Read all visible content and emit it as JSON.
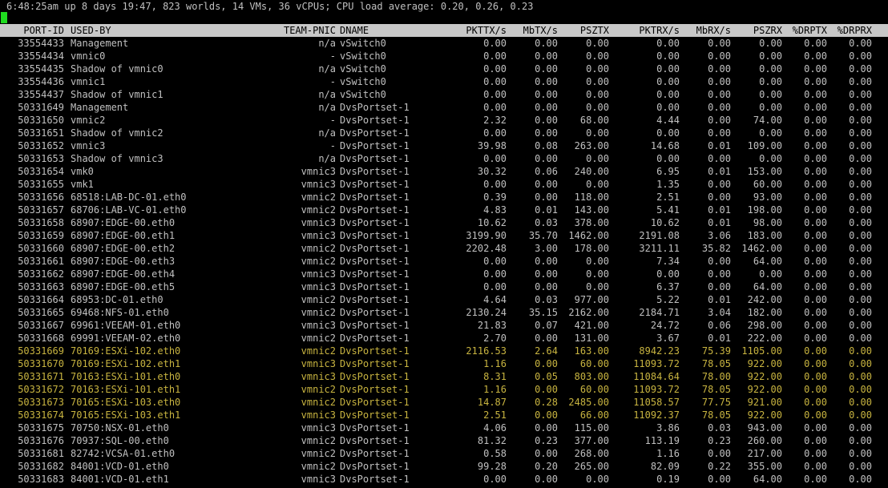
{
  "status_line": "6:48:25am up 8 days 19:47, 823 worlds, 14 VMs, 36 vCPUs; CPU load average: 0.20, 0.26, 0.23",
  "columns": [
    "PORT-ID",
    "USED-BY",
    "TEAM-PNIC",
    "DNAME",
    "PKTTX/s",
    "MbTX/s",
    "PSZTX",
    "PKTRX/s",
    "MbRX/s",
    "PSZRX",
    "%DRPTX",
    "%DRPRX"
  ],
  "rows": [
    [
      "33554433",
      "Management",
      "n/a",
      "vSwitch0",
      "0.00",
      "0.00",
      "0.00",
      "0.00",
      "0.00",
      "0.00",
      "0.00",
      "0.00"
    ],
    [
      "33554434",
      "vmnic0",
      "-",
      "vSwitch0",
      "0.00",
      "0.00",
      "0.00",
      "0.00",
      "0.00",
      "0.00",
      "0.00",
      "0.00"
    ],
    [
      "33554435",
      "Shadow of vmnic0",
      "n/a",
      "vSwitch0",
      "0.00",
      "0.00",
      "0.00",
      "0.00",
      "0.00",
      "0.00",
      "0.00",
      "0.00"
    ],
    [
      "33554436",
      "vmnic1",
      "-",
      "vSwitch0",
      "0.00",
      "0.00",
      "0.00",
      "0.00",
      "0.00",
      "0.00",
      "0.00",
      "0.00"
    ],
    [
      "33554437",
      "Shadow of vmnic1",
      "n/a",
      "vSwitch0",
      "0.00",
      "0.00",
      "0.00",
      "0.00",
      "0.00",
      "0.00",
      "0.00",
      "0.00"
    ],
    [
      "50331649",
      "Management",
      "n/a",
      "DvsPortset-1",
      "0.00",
      "0.00",
      "0.00",
      "0.00",
      "0.00",
      "0.00",
      "0.00",
      "0.00"
    ],
    [
      "50331650",
      "vmnic2",
      "-",
      "DvsPortset-1",
      "2.32",
      "0.00",
      "68.00",
      "4.44",
      "0.00",
      "74.00",
      "0.00",
      "0.00"
    ],
    [
      "50331651",
      "Shadow of vmnic2",
      "n/a",
      "DvsPortset-1",
      "0.00",
      "0.00",
      "0.00",
      "0.00",
      "0.00",
      "0.00",
      "0.00",
      "0.00"
    ],
    [
      "50331652",
      "vmnic3",
      "-",
      "DvsPortset-1",
      "39.98",
      "0.08",
      "263.00",
      "14.68",
      "0.01",
      "109.00",
      "0.00",
      "0.00"
    ],
    [
      "50331653",
      "Shadow of vmnic3",
      "n/a",
      "DvsPortset-1",
      "0.00",
      "0.00",
      "0.00",
      "0.00",
      "0.00",
      "0.00",
      "0.00",
      "0.00"
    ],
    [
      "50331654",
      "vmk0",
      "vmnic3",
      "DvsPortset-1",
      "30.32",
      "0.06",
      "240.00",
      "6.95",
      "0.01",
      "153.00",
      "0.00",
      "0.00"
    ],
    [
      "50331655",
      "vmk1",
      "vmnic3",
      "DvsPortset-1",
      "0.00",
      "0.00",
      "0.00",
      "1.35",
      "0.00",
      "60.00",
      "0.00",
      "0.00"
    ],
    [
      "50331656",
      "68518:LAB-DC-01.eth0",
      "vmnic2",
      "DvsPortset-1",
      "0.39",
      "0.00",
      "118.00",
      "2.51",
      "0.00",
      "93.00",
      "0.00",
      "0.00"
    ],
    [
      "50331657",
      "68706:LAB-VC-01.eth0",
      "vmnic2",
      "DvsPortset-1",
      "4.83",
      "0.01",
      "143.00",
      "5.41",
      "0.01",
      "198.00",
      "0.00",
      "0.00"
    ],
    [
      "50331658",
      "68907:EDGE-00.eth0",
      "vmnic3",
      "DvsPortset-1",
      "10.62",
      "0.03",
      "378.00",
      "10.62",
      "0.01",
      "98.00",
      "0.00",
      "0.00"
    ],
    [
      "50331659",
      "68907:EDGE-00.eth1",
      "vmnic3",
      "DvsPortset-1",
      "3199.90",
      "35.70",
      "1462.00",
      "2191.08",
      "3.06",
      "183.00",
      "0.00",
      "0.00"
    ],
    [
      "50331660",
      "68907:EDGE-00.eth2",
      "vmnic2",
      "DvsPortset-1",
      "2202.48",
      "3.00",
      "178.00",
      "3211.11",
      "35.82",
      "1462.00",
      "0.00",
      "0.00"
    ],
    [
      "50331661",
      "68907:EDGE-00.eth3",
      "vmnic2",
      "DvsPortset-1",
      "0.00",
      "0.00",
      "0.00",
      "7.34",
      "0.00",
      "64.00",
      "0.00",
      "0.00"
    ],
    [
      "50331662",
      "68907:EDGE-00.eth4",
      "vmnic3",
      "DvsPortset-1",
      "0.00",
      "0.00",
      "0.00",
      "0.00",
      "0.00",
      "0.00",
      "0.00",
      "0.00"
    ],
    [
      "50331663",
      "68907:EDGE-00.eth5",
      "vmnic3",
      "DvsPortset-1",
      "0.00",
      "0.00",
      "0.00",
      "6.37",
      "0.00",
      "64.00",
      "0.00",
      "0.00"
    ],
    [
      "50331664",
      "68953:DC-01.eth0",
      "vmnic2",
      "DvsPortset-1",
      "4.64",
      "0.03",
      "977.00",
      "5.22",
      "0.01",
      "242.00",
      "0.00",
      "0.00"
    ],
    [
      "50331665",
      "69468:NFS-01.eth0",
      "vmnic2",
      "DvsPortset-1",
      "2130.24",
      "35.15",
      "2162.00",
      "2184.71",
      "3.04",
      "182.00",
      "0.00",
      "0.00"
    ],
    [
      "50331667",
      "69961:VEEAM-01.eth0",
      "vmnic3",
      "DvsPortset-1",
      "21.83",
      "0.07",
      "421.00",
      "24.72",
      "0.06",
      "298.00",
      "0.00",
      "0.00"
    ],
    [
      "50331668",
      "69991:VEEAM-02.eth0",
      "vmnic2",
      "DvsPortset-1",
      "2.70",
      "0.00",
      "131.00",
      "3.67",
      "0.01",
      "222.00",
      "0.00",
      "0.00"
    ],
    [
      "50331669",
      "70169:ESXi-102.eth0",
      "vmnic2",
      "DvsPortset-1",
      "2116.53",
      "2.64",
      "163.00",
      "8942.23",
      "75.39",
      "1105.00",
      "0.00",
      "0.00"
    ],
    [
      "50331670",
      "70169:ESXi-102.eth1",
      "vmnic3",
      "DvsPortset-1",
      "1.16",
      "0.00",
      "60.00",
      "11093.72",
      "78.05",
      "922.00",
      "0.00",
      "0.00"
    ],
    [
      "50331671",
      "70163:ESXi-101.eth0",
      "vmnic3",
      "DvsPortset-1",
      "8.31",
      "0.05",
      "803.00",
      "11084.64",
      "78.00",
      "922.00",
      "0.00",
      "0.00"
    ],
    [
      "50331672",
      "70163:ESXi-101.eth1",
      "vmnic2",
      "DvsPortset-1",
      "1.16",
      "0.00",
      "60.00",
      "11093.72",
      "78.05",
      "922.00",
      "0.00",
      "0.00"
    ],
    [
      "50331673",
      "70165:ESXi-103.eth0",
      "vmnic2",
      "DvsPortset-1",
      "14.87",
      "0.28",
      "2485.00",
      "11058.57",
      "77.75",
      "921.00",
      "0.00",
      "0.00"
    ],
    [
      "50331674",
      "70165:ESXi-103.eth1",
      "vmnic3",
      "DvsPortset-1",
      "2.51",
      "0.00",
      "66.00",
      "11092.37",
      "78.05",
      "922.00",
      "0.00",
      "0.00"
    ],
    [
      "50331675",
      "70750:NSX-01.eth0",
      "vmnic3",
      "DvsPortset-1",
      "4.06",
      "0.00",
      "115.00",
      "3.86",
      "0.03",
      "943.00",
      "0.00",
      "0.00"
    ],
    [
      "50331676",
      "70937:SQL-00.eth0",
      "vmnic2",
      "DvsPortset-1",
      "81.32",
      "0.23",
      "377.00",
      "113.19",
      "0.23",
      "260.00",
      "0.00",
      "0.00"
    ],
    [
      "50331681",
      "82742:VCSA-01.eth0",
      "vmnic2",
      "DvsPortset-1",
      "0.58",
      "0.00",
      "268.00",
      "1.16",
      "0.00",
      "217.00",
      "0.00",
      "0.00"
    ],
    [
      "50331682",
      "84001:VCD-01.eth0",
      "vmnic2",
      "DvsPortset-1",
      "99.28",
      "0.20",
      "265.00",
      "82.09",
      "0.22",
      "355.00",
      "0.00",
      "0.00"
    ],
    [
      "50331683",
      "84001:VCD-01.eth1",
      "vmnic3",
      "DvsPortset-1",
      "0.00",
      "0.00",
      "0.00",
      "0.19",
      "0.00",
      "64.00",
      "0.00",
      "0.00"
    ]
  ],
  "highlighted_rows": [
    24,
    25,
    26,
    27,
    28,
    29
  ],
  "colors": {
    "background": "#000000",
    "text": "#c0c0c0",
    "header_bg": "#c8c8c8",
    "highlight": "#c8b440",
    "cursor": "#1fdc1f"
  }
}
